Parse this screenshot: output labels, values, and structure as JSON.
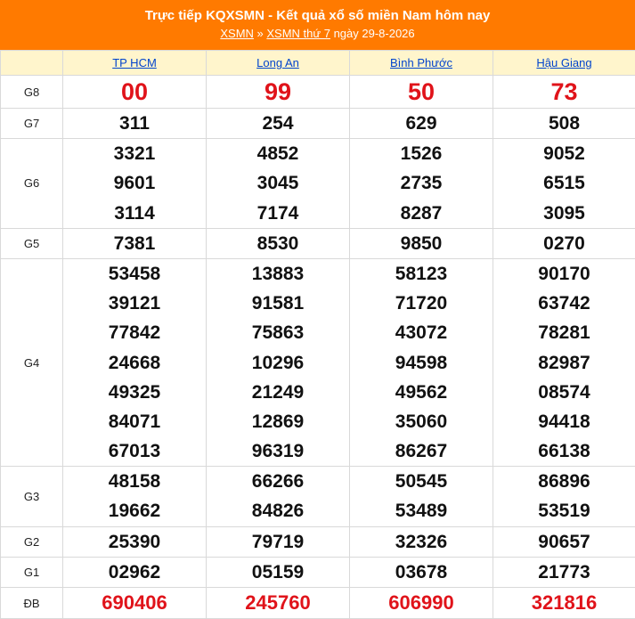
{
  "header": {
    "title": "Trực tiếp KQXSMN - Kết quả xổ số miền Nam hôm nay",
    "crumb1": "XSMN",
    "sep": " » ",
    "crumb2": "XSMN thứ 7",
    "date_text": " ngày 29-8-2026"
  },
  "provinces": [
    "TP HCM",
    "Long An",
    "Bình Phước",
    "Hậu Giang"
  ],
  "rows": [
    {
      "label": "G8",
      "style": "big",
      "values": [
        [
          "00"
        ],
        [
          "99"
        ],
        [
          "50"
        ],
        [
          "73"
        ]
      ]
    },
    {
      "label": "G7",
      "style": "normal",
      "values": [
        [
          "311"
        ],
        [
          "254"
        ],
        [
          "629"
        ],
        [
          "508"
        ]
      ]
    },
    {
      "label": "G6",
      "style": "normal",
      "values": [
        [
          "3321",
          "9601",
          "3114"
        ],
        [
          "4852",
          "3045",
          "7174"
        ],
        [
          "1526",
          "2735",
          "8287"
        ],
        [
          "9052",
          "6515",
          "3095"
        ]
      ]
    },
    {
      "label": "G5",
      "style": "normal",
      "values": [
        [
          "7381"
        ],
        [
          "8530"
        ],
        [
          "9850"
        ],
        [
          "0270"
        ]
      ]
    },
    {
      "label": "G4",
      "style": "normal",
      "values": [
        [
          "53458",
          "39121",
          "77842",
          "24668",
          "49325",
          "84071",
          "67013"
        ],
        [
          "13883",
          "91581",
          "75863",
          "10296",
          "21249",
          "12869",
          "96319"
        ],
        [
          "58123",
          "71720",
          "43072",
          "94598",
          "49562",
          "35060",
          "86267"
        ],
        [
          "90170",
          "63742",
          "78281",
          "82987",
          "08574",
          "94418",
          "66138"
        ]
      ]
    },
    {
      "label": "G3",
      "style": "normal",
      "values": [
        [
          "48158",
          "19662"
        ],
        [
          "66266",
          "84826"
        ],
        [
          "50545",
          "53489"
        ],
        [
          "86896",
          "53519"
        ]
      ]
    },
    {
      "label": "G2",
      "style": "normal",
      "values": [
        [
          "25390"
        ],
        [
          "79719"
        ],
        [
          "32326"
        ],
        [
          "90657"
        ]
      ]
    },
    {
      "label": "G1",
      "style": "normal",
      "values": [
        [
          "02962"
        ],
        [
          "05159"
        ],
        [
          "03678"
        ],
        [
          "21773"
        ]
      ]
    },
    {
      "label": "ĐB",
      "style": "db",
      "values": [
        [
          "690406"
        ],
        [
          "245760"
        ],
        [
          "606990"
        ],
        [
          "321816"
        ]
      ]
    }
  ],
  "colors": {
    "header_bg": "#ff7a00",
    "province_row_bg": "#fff5cc",
    "highlight_red": "#e0131a",
    "link_blue": "#0044cc"
  }
}
